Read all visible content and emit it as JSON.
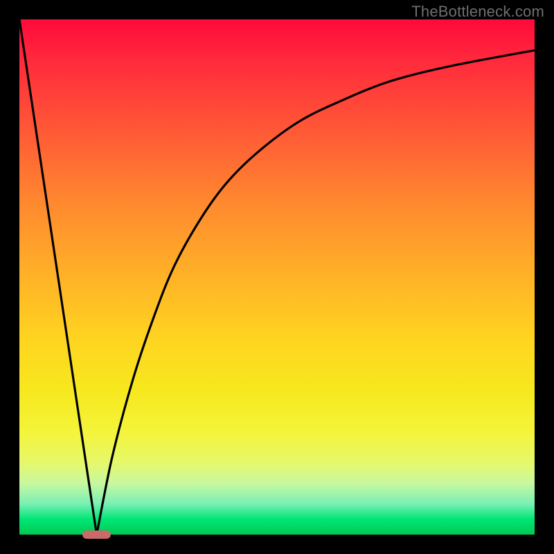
{
  "watermark": "TheBottleneck.com",
  "chart_data": {
    "type": "line",
    "title": "",
    "xlabel": "",
    "ylabel": "",
    "xlim": [
      0,
      100
    ],
    "ylim": [
      0,
      100
    ],
    "series": [
      {
        "name": "left-line",
        "x": [
          0,
          15
        ],
        "values": [
          100,
          0
        ]
      },
      {
        "name": "right-curve",
        "x": [
          15,
          18,
          22,
          26,
          30,
          35,
          40,
          46,
          54,
          62,
          72,
          84,
          100
        ],
        "values": [
          0,
          15,
          30,
          42,
          52,
          61,
          68,
          74,
          80,
          84,
          88,
          91,
          94
        ]
      }
    ],
    "marker": {
      "name": "minimum-pill",
      "x": 15,
      "y": 0,
      "width_pct": 5.5,
      "height_pct": 1.6,
      "color": "#cc6a6a"
    },
    "background_gradient": {
      "top": "#ff0a3a",
      "bottom": "#00c853"
    }
  }
}
